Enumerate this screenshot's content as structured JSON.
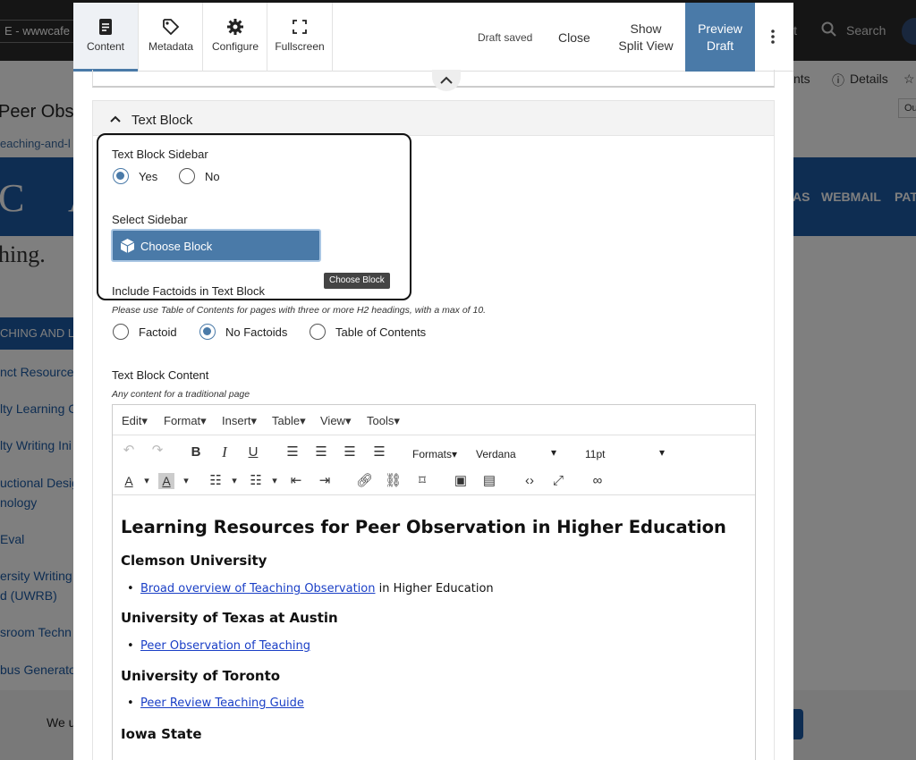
{
  "background": {
    "site_label": "E - wwwcafe",
    "topbar_partial_label": "it",
    "search_label": "Search",
    "contents_partial": "nts",
    "details_label": "Details",
    "dropdown_partial": "Ou",
    "page_title_partial": "Peer Obse",
    "breadcrumb_partial": "eaching-and-l",
    "band_letters": [
      "C",
      "A"
    ],
    "nav_items": [
      "AS",
      "WEBMAIL",
      "PAT"
    ],
    "hero_partial": "hing.",
    "sidebar_heading": "CHING AND L",
    "sidebar_items": [
      "nct Resource",
      "lty Learning C",
      "lty Writing Ini",
      "uctional Desig",
      "nology",
      "Eval",
      "ersity Writing",
      "d (UWRB)",
      "sroom Techn",
      "bus Generato"
    ],
    "cookie_text_partial": "We u"
  },
  "toolbar": {
    "tabs": [
      {
        "label": "Content",
        "icon": "document-icon"
      },
      {
        "label": "Metadata",
        "icon": "tag-icon"
      },
      {
        "label": "Configure",
        "icon": "gear-icon"
      },
      {
        "label": "Fullscreen",
        "icon": "fullscreen-icon"
      }
    ],
    "draft_status": "Draft saved",
    "close_label": "Close",
    "split_view_line1": "Show",
    "split_view_line2": "Split View",
    "preview_line1": "Preview",
    "preview_line2": "Draft"
  },
  "text_block": {
    "section_title": "Text Block",
    "sidebar_field": {
      "label": "Text Block Sidebar",
      "options": [
        "Yes",
        "No"
      ],
      "selected": "Yes"
    },
    "select_sidebar": {
      "label": "Select Sidebar",
      "button_label": "Choose Block",
      "tooltip": "Choose Block"
    },
    "factoids_field": {
      "label": "Include Factoids in Text Block",
      "help": "Please use Table of Contents for pages with three or more H2 headings, with a max of 10.",
      "options": [
        "Factoid",
        "No Factoids",
        "Table of Contents"
      ],
      "selected": "No Factoids"
    },
    "content_field": {
      "label": "Text Block Content",
      "help": "Any content for a traditional page"
    }
  },
  "editor": {
    "menus": [
      "Edit",
      "Format",
      "Insert",
      "Table",
      "View",
      "Tools"
    ],
    "formats_label": "Formats",
    "font_family": "Verdana",
    "font_size": "11pt",
    "heading": "Learning Resources for Peer Observation in Higher Education",
    "sections": [
      {
        "name": "Clemson University",
        "link": "Broad overview of Teaching Observation",
        "suffix": " in Higher Education"
      },
      {
        "name": "University of Texas at Austin",
        "link": "Peer Observation of Teaching",
        "suffix": ""
      },
      {
        "name": "University of Toronto",
        "link": "Peer Review Teaching Guide",
        "suffix": ""
      },
      {
        "name": "Iowa State",
        "link": "",
        "suffix": ""
      }
    ]
  },
  "colors": {
    "accent": "#4a7aa8",
    "link": "#1a3fc6",
    "site_blue": "#1d5ba5"
  }
}
